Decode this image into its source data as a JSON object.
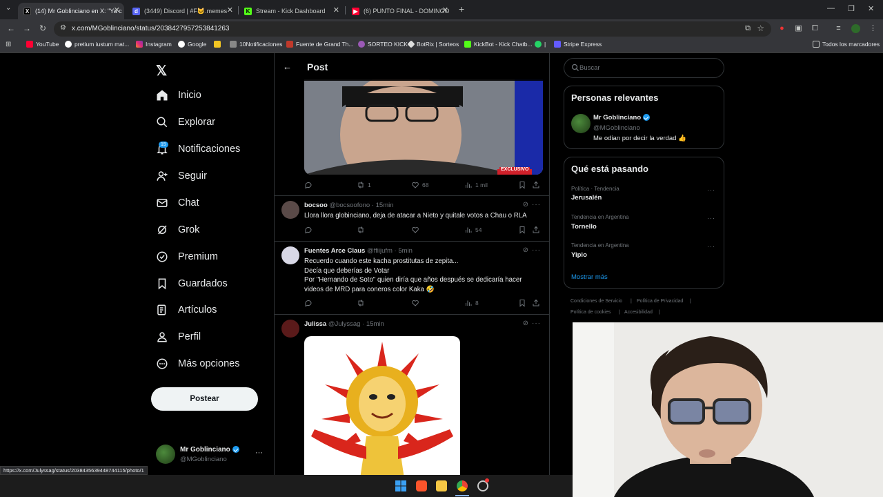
{
  "browser": {
    "tabs": [
      {
        "label": "(14) Mr Goblinciano en X: \"Ya c",
        "favicon": "x-icon",
        "active": true
      },
      {
        "label": "(3449) Discord | #F🐱.memes",
        "favicon": "discord-icon",
        "active": false
      },
      {
        "label": "Stream - Kick Dashboard",
        "favicon": "kick-icon",
        "active": false
      },
      {
        "label": "(6) PUNTO FINAL - DOMINGO",
        "favicon": "youtube-icon",
        "active": false
      }
    ],
    "new_tab": "+",
    "url": "x.com/MGoblinciano/status/2038427957253841263",
    "bookmarks": [
      "YouTube",
      "pretium iustum mat...",
      "Instagram",
      "Google",
      "",
      "10Notificaciones",
      "Fuente de Grand Th...",
      "SORTEO KICK",
      "BotRix | Sorteos",
      "KickBot - Kick Chatb...",
      "|",
      "Stripe Express"
    ],
    "all_bookmarks": "Todos los marcadores",
    "status_url": "https://x.com/Julyssag/status/2038435639448744115/photo/1"
  },
  "nav": {
    "items": [
      {
        "label": "Inicio",
        "icon": "home-icon"
      },
      {
        "label": "Explorar",
        "icon": "search-icon"
      },
      {
        "label": "Notificaciones",
        "icon": "bell-icon"
      },
      {
        "label": "Seguir",
        "icon": "follow-icon"
      },
      {
        "label": "Chat",
        "icon": "mail-icon"
      },
      {
        "label": "Grok",
        "icon": "grok-icon"
      },
      {
        "label": "Premium",
        "icon": "premium-icon"
      },
      {
        "label": "Guardados",
        "icon": "bookmark-icon"
      },
      {
        "label": "Artículos",
        "icon": "articles-icon"
      },
      {
        "label": "Perfil",
        "icon": "person-icon"
      },
      {
        "label": "Más opciones",
        "icon": "more-icon"
      }
    ],
    "notif_count": "15",
    "post_button": "Postear",
    "profile": {
      "name": "Mr Goblinciano",
      "handle": "@MGoblinciano",
      "more": "···"
    }
  },
  "post": {
    "header": "Post",
    "top_badge": "EXCLUSIVO",
    "top_actions": {
      "reposts": "1",
      "likes": "68",
      "views": "1 mil"
    }
  },
  "replies": [
    {
      "name": "bocsoo",
      "handle": "@bocsoofono",
      "time": "· 15min",
      "lines": [
        "Llora llora globinciano, deja de atacar a Nieto y quitale votos a Chau o RLA"
      ],
      "views": "54"
    },
    {
      "name": "Fuentes Arce Claus",
      "handle": "@ffiijufm",
      "time": "· 5min",
      "lines": [
        "Recuerdo cuando este kacha prostitutas de zepita...",
        "Decía que deberías de Votar",
        "Por \"Hernando de Soto\" quien diría que años después se dedicaría hacer",
        "videos de MRD para coneros color Kaka 🤣"
      ],
      "views": "8"
    },
    {
      "name": "Julissa",
      "handle": "@Julyssag",
      "time": "· 15min",
      "lines": [],
      "views": ""
    }
  ],
  "sidebar": {
    "search_placeholder": "Buscar",
    "relevant": {
      "title": "Personas relevantes",
      "name": "Mr Goblinciano",
      "handle": "@MGoblinciano",
      "bio": "Me odian por decir la verdad 👍"
    },
    "trends": {
      "title": "Qué está pasando",
      "items": [
        {
          "category": "Política · Tendencia",
          "name": "Jerusalén"
        },
        {
          "category": "Tendencia en Argentina",
          "name": "Tornello"
        },
        {
          "category": "Tendencia en Argentina",
          "name": "Yipio"
        }
      ],
      "more": "Mostrar más"
    },
    "footer": [
      "Condiciones de Servicio",
      "|",
      "Política de Privacidad",
      "|",
      "Política de cookies",
      "|",
      "Accesibilidad",
      "|"
    ]
  },
  "colors": {
    "accent": "#1d9bf0",
    "bg": "#000000",
    "border": "#2f3336",
    "muted": "#71767b"
  }
}
